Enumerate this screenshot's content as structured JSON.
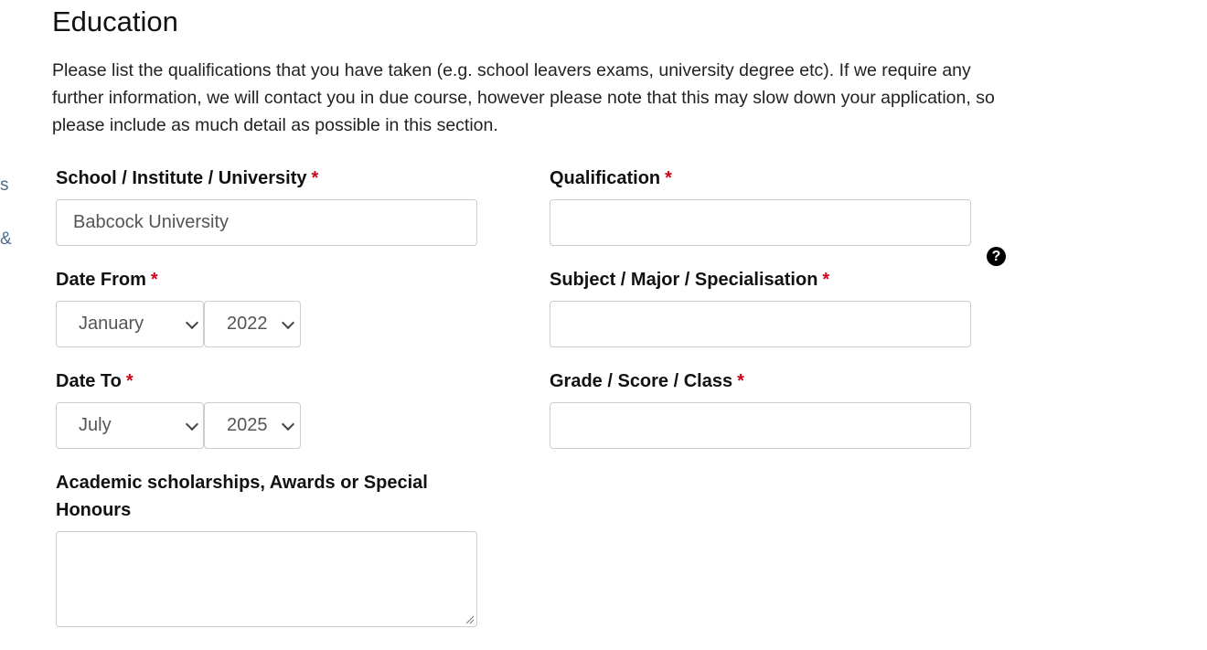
{
  "sidebar_fragments": [
    "s",
    "&"
  ],
  "section": {
    "title": "Education",
    "intro": "Please list the qualifications that you have taken (e.g. school leavers exams, university degree etc). If we require any further information, we will contact you in due course, however please note that this may slow down your application, so please include as much detail as possible in this section."
  },
  "required_marker": "*",
  "fields": {
    "school": {
      "label": "School / Institute / University",
      "value": "Babcock University"
    },
    "qualification": {
      "label": "Qualification",
      "value": ""
    },
    "date_from": {
      "label": "Date From",
      "month": "January",
      "year": "2022"
    },
    "subject": {
      "label": "Subject / Major / Specialisation",
      "value": ""
    },
    "date_to": {
      "label": "Date To",
      "month": "July",
      "year": "2025"
    },
    "grade": {
      "label": "Grade / Score / Class",
      "value": ""
    },
    "awards": {
      "label": "Academic scholarships, Awards or Special Honours",
      "value": ""
    }
  },
  "icons": {
    "help": {
      "name": "question-circle-icon",
      "glyph": "?"
    }
  }
}
